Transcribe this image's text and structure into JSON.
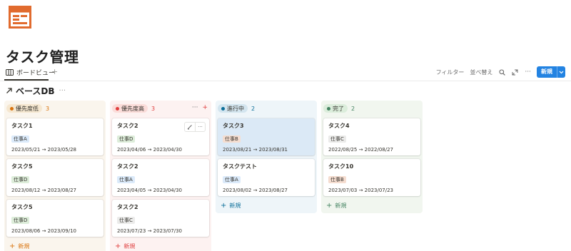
{
  "page": {
    "icon": "kanban-board-icon",
    "title": "タスク管理"
  },
  "view": {
    "tab_label": "ボードビュー",
    "tab_icon": "board-view-icon",
    "add_icon": "plus-icon"
  },
  "toolbar": {
    "filter_label": "フィルター",
    "sort_label": "並べ替え",
    "search_icon": "search-icon",
    "expand_icon": "expand-icon",
    "more_icon": "ellipsis-icon",
    "new_label": "新規",
    "new_caret_icon": "chevron-down-icon",
    "accent_color": "#2383e2"
  },
  "database": {
    "link_icon": "arrow-up-right-icon",
    "name": "ベースDB",
    "more_icon": "ellipsis-icon"
  },
  "columns": [
    {
      "status": "優先度低",
      "count": "3",
      "bg": "#faf5ed",
      "pill_bg": "#f5e7d0",
      "dot": "#d9730d",
      "count_color": "#d9730d",
      "new_label": "新規",
      "new_color": "#d9730d",
      "cards": [
        {
          "title": "タスク1",
          "tag": "仕事A",
          "tag_bg": "#dbeafa",
          "dates": "2023/05/21 → 2023/05/28"
        },
        {
          "title": "タスク5",
          "tag": "仕事D",
          "tag_bg": "#ddedda",
          "dates": "2023/08/12 → 2023/08/27"
        },
        {
          "title": "タスク5",
          "tag": "仕事D",
          "tag_bg": "#ddedda",
          "dates": "2023/08/06 → 2023/09/10"
        }
      ]
    },
    {
      "status": "優先度高",
      "count": "3",
      "bg": "#fdf2f1",
      "pill_bg": "#fbdcd9",
      "dot": "#e03e3e",
      "count_color": "#e03e3e",
      "new_label": "新規",
      "new_color": "#e03e3e",
      "actions": {
        "more_icon": "ellipsis-icon",
        "add_icon": "plus-icon"
      },
      "cards": [
        {
          "title": "タスク2",
          "tag": "仕事D",
          "tag_bg": "#ddedda",
          "dates": "2023/04/06 → 2023/04/30",
          "hover": true
        },
        {
          "title": "タスク2",
          "tag": "仕事A",
          "tag_bg": "#dbeafa",
          "dates": "2023/04/05 → 2023/04/30"
        },
        {
          "title": "タスク2",
          "tag": "仕事C",
          "tag_bg": "#ebebea",
          "dates": "2023/07/23 → 2023/07/30"
        }
      ]
    },
    {
      "status": "進行中",
      "count": "2",
      "bg": "#eef5f9",
      "pill_bg": "#d3e5ef",
      "dot": "#0b6e99",
      "count_color": "#0b6e99",
      "new_label": "新規",
      "new_color": "#0b6e99",
      "cards": [
        {
          "title": "タスク3",
          "tag": "仕事B",
          "tag_bg": "#f5ddd0",
          "dates": "2023/08/21 → 2023/08/31",
          "selected": true
        },
        {
          "title": "タスクテスト",
          "tag": "仕事A",
          "tag_bg": "#dbeafa",
          "dates": "2023/08/02 → 2023/08/27"
        }
      ]
    },
    {
      "status": "完了",
      "count": "2",
      "bg": "#f1f6ef",
      "pill_bg": "#dbeddb",
      "dot": "#448361",
      "count_color": "#448361",
      "new_label": "新規",
      "new_color": "#448361",
      "cards": [
        {
          "title": "タスク4",
          "tag": "仕事C",
          "tag_bg": "#ebebea",
          "dates": "2022/08/25 → 2022/08/27"
        },
        {
          "title": "タスク10",
          "tag": "仕事B",
          "tag_bg": "#f5ddd0",
          "dates": "2023/07/03 → 2023/07/23"
        }
      ]
    }
  ]
}
